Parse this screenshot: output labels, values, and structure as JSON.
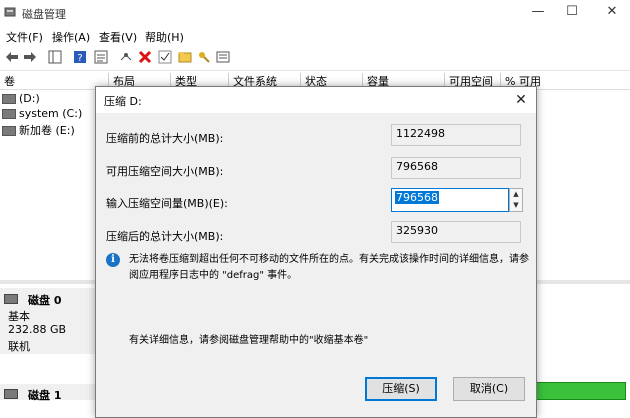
{
  "window": {
    "title": "磁盘管理",
    "minimize_icon": "minimize-icon",
    "maximize_icon": "maximize-icon",
    "close_icon": "close-icon"
  },
  "menu": [
    "文件(F)",
    "操作(A)",
    "查看(V)",
    "帮助(H)"
  ],
  "toolbar_icons": [
    "back-arrow-icon",
    "forward-arrow-icon",
    "console-tree-icon",
    "help-icon",
    "properties-icon",
    "connect-icon",
    "delete-icon",
    "check-icon",
    "folder-icon",
    "list-icon"
  ],
  "columns": [
    "卷",
    "布局",
    "类型",
    "文件系统",
    "状态",
    "容量",
    "可用空间",
    "% 可用"
  ],
  "volumes": [
    {
      "name": "(D:)"
    },
    {
      "name": "system (C:)"
    },
    {
      "name": "新加卷 (E:)"
    }
  ],
  "disks": [
    {
      "name": "磁盘 0",
      "type": "基本",
      "size": "232.88 GB",
      "status": "联机"
    },
    {
      "name": "磁盘 1"
    }
  ],
  "dialog": {
    "title": "压缩 D:",
    "total_before_label": "压缩前的总计大小(MB):",
    "total_before_value": "1122498",
    "available_label": "可用压缩空间大小(MB):",
    "available_value": "796568",
    "input_label": "输入压缩空间量(MB)(E):",
    "input_value": "796568",
    "total_after_label": "压缩后的总计大小(MB):",
    "total_after_value": "325930",
    "info_text": "无法将卷压缩到超出任何不可移动的文件所在的点。有关完成该操作时间的详细信息，请参阅应用程序日志中的 \"defrag\" 事件。",
    "help_text": "有关详细信息，请参阅磁盘管理帮助中的\"收缩基本卷\"",
    "shrink_button": "压缩(S)",
    "cancel_button": "取消(C)"
  },
  "colors": {
    "accent": "#0078d7",
    "info_icon": "#1b73c8",
    "primary_partition": "#3cc13c"
  }
}
